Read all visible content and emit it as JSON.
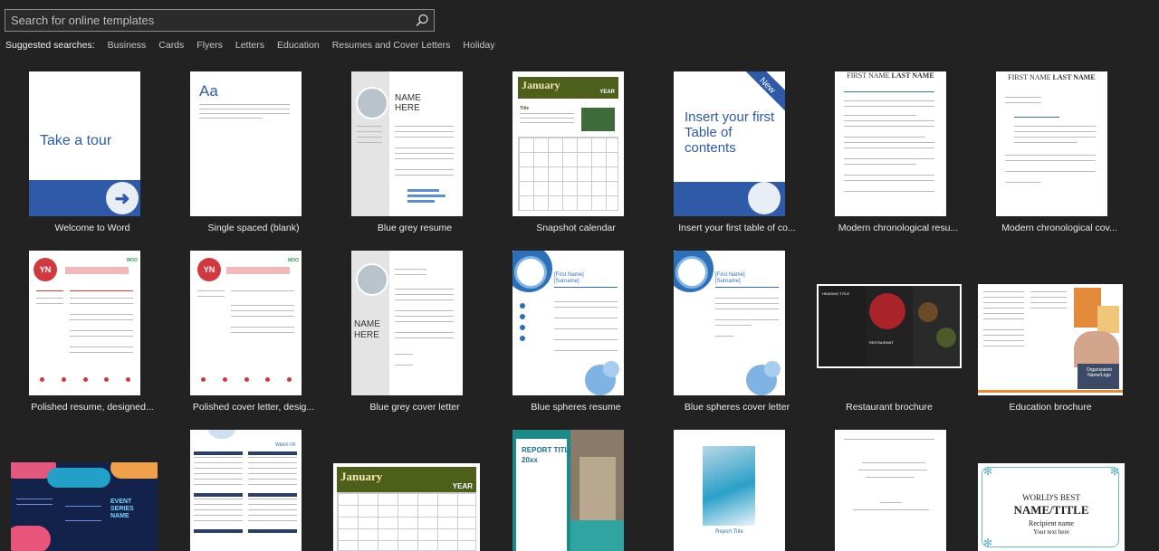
{
  "search": {
    "placeholder": "Search for online templates"
  },
  "suggested": {
    "label": "Suggested searches:",
    "links": [
      "Business",
      "Cards",
      "Flyers",
      "Letters",
      "Education",
      "Resumes and Cover Letters",
      "Holiday"
    ]
  },
  "templates": [
    {
      "caption": "Welcome to Word",
      "thumb_text": "Take a tour"
    },
    {
      "caption": "Single spaced (blank)",
      "thumb_text": "Aa"
    },
    {
      "caption": "Blue grey resume",
      "thumb_name": "NAME HERE"
    },
    {
      "caption": "Snapshot calendar",
      "month": "January",
      "year": "YEAR",
      "title": "Title"
    },
    {
      "caption": "Insert your first table of co...",
      "thumb_text": "Insert your first Table of contents",
      "badge": "New"
    },
    {
      "caption": "Modern chronological resu...",
      "heading_first": "FIRST NAME",
      "heading_last": "LAST NAME"
    },
    {
      "caption": "Modern chronological cov...",
      "heading_first": "FIRST NAME",
      "heading_last": "LAST NAME"
    },
    {
      "caption": "Polished resume, designed...",
      "initials": "YN",
      "brand": "MOO"
    },
    {
      "caption": "Polished cover letter, desig...",
      "initials": "YN",
      "brand": "MOO"
    },
    {
      "caption": "Blue grey cover letter",
      "thumb_name": "NAME HERE"
    },
    {
      "caption": "Blue spheres resume",
      "first": "[First Name]",
      "surname": "[Surname]"
    },
    {
      "caption": "Blue spheres cover letter",
      "first": "[First Name]",
      "surname": "[Surname]"
    },
    {
      "caption": "Restaurant brochure",
      "heading": "HEADING TITLE",
      "tag": "RESTAURANT"
    },
    {
      "caption": "Education brochure",
      "org": "Organization Name/Logo"
    },
    {
      "caption": "",
      "lines": [
        "EVENT",
        "SERIES",
        "NAME"
      ]
    },
    {
      "caption": "",
      "week": "WEEK OF"
    },
    {
      "caption": "",
      "month": "January",
      "year": "YEAR"
    },
    {
      "caption": "",
      "title": "REPORT TITLE",
      "year": "20xx"
    },
    {
      "caption": "",
      "title": "Report Title"
    },
    {
      "caption": "",
      "title": ""
    },
    {
      "caption": "",
      "line1": "WORLD'S BEST",
      "line2": "NAME/TITLE",
      "line3": "Recipient name",
      "line4": "Your text here"
    }
  ],
  "colors": {
    "accent_blue": "#2e5aa8",
    "calendar_green": "#4e5f1c",
    "resume_red": "#d0393f",
    "background": "#222222"
  }
}
